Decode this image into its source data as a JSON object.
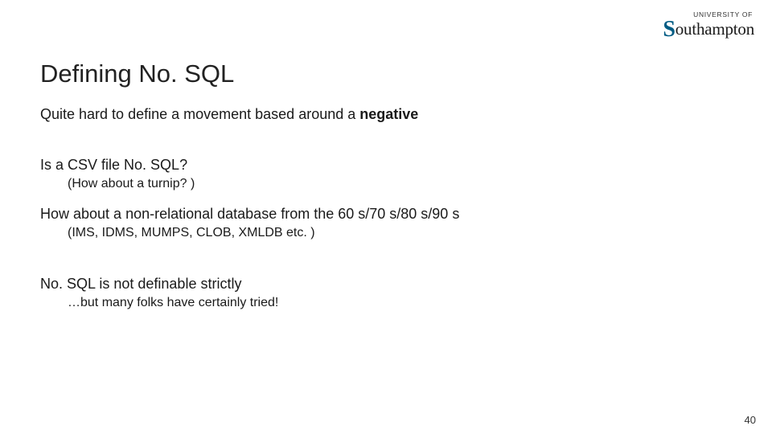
{
  "logo": {
    "pretitle": "UNIVERSITY OF",
    "name_rest": "outhampton"
  },
  "title": "Defining No. SQL",
  "lines": {
    "intro_pre": "Quite hard to define a movement based around a ",
    "intro_bold": "negative",
    "csv_q": "Is a CSV file No. SQL?",
    "turnip": "(How about a turnip? )",
    "nonrel": "How about a non-relational database from the 60 s/70 s/80 s/90 s",
    "examples": "(IMS, IDMS, MUMPS, CLOB, XMLDB etc. )",
    "notdef": "No. SQL is not definable strictly",
    "tried": "…but many folks have certainly tried!"
  },
  "page_number": "40"
}
